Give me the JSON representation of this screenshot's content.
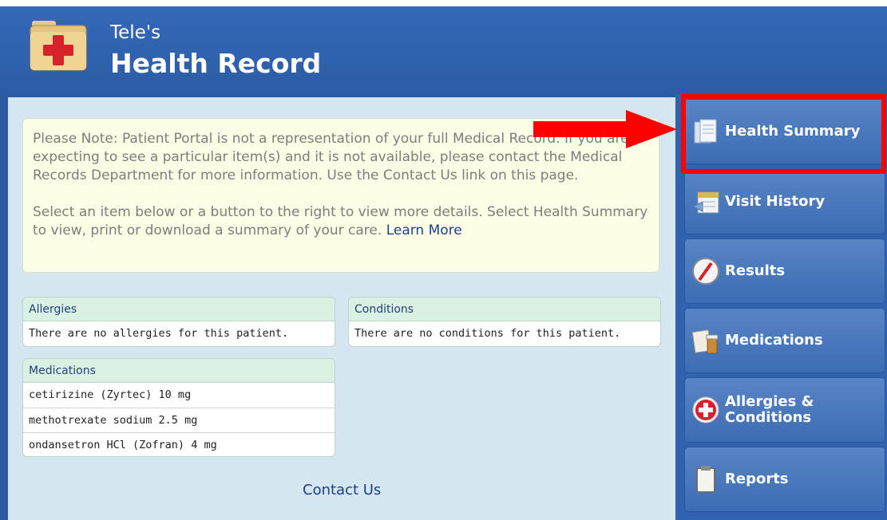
{
  "header": {
    "subtitle": "Tele's",
    "title": "Health Record"
  },
  "note": {
    "paragraph1": "Please Note: Patient Portal is not a representation of your full Medical Record. If you are expecting to see a particular item(s) and it is not available, please contact the Medical Records Department for more information. Use the Contact Us link on this page.",
    "paragraph2": "Select an item below or a button to the right to view more details. Select Health Summary to view, print or download a summary of your care.",
    "learn_more": "Learn More"
  },
  "allergies": {
    "title": "Allergies",
    "rows": [
      "There are no allergies for this patient."
    ]
  },
  "conditions": {
    "title": "Conditions",
    "rows": [
      "There are no conditions for this patient."
    ]
  },
  "medications": {
    "title": "Medications",
    "rows": [
      "cetirizine (Zyrtec) 10 mg",
      "methotrexate sodium 2.5 mg",
      "ondansetron HCl (Zofran) 4 mg"
    ]
  },
  "contact_us": "Contact Us",
  "sidebar": {
    "items": [
      {
        "label": "Health Summary",
        "icon": "document-icon"
      },
      {
        "label": "Visit History",
        "icon": "calendar-icon"
      },
      {
        "label": "Results",
        "icon": "gauge-icon"
      },
      {
        "label": "Medications",
        "icon": "prescription-icon"
      },
      {
        "label": "Allergies & Conditions",
        "icon": "medical-cross-icon"
      },
      {
        "label": "Reports",
        "icon": "clipboard-icon"
      }
    ]
  },
  "colors": {
    "header_blue": "#2c5ca6",
    "annotation_red": "#ff0000",
    "card_header": "#d9f0e2",
    "note_bg": "#fefee6"
  }
}
